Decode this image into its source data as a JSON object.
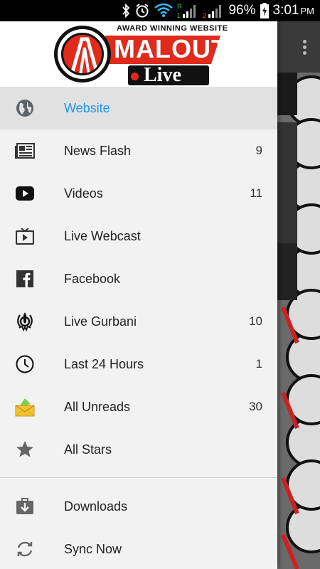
{
  "status_bar": {
    "battery": "96%",
    "time": "3:01",
    "ampm": "PM",
    "sim1_label": "R",
    "sim1_num": "1",
    "sim2_num": "2"
  },
  "header": {
    "logo_tagline": "AWARD WINNING WEBSITE",
    "logo_name": "MALOUT",
    "logo_live": "Live"
  },
  "nav": {
    "items": [
      {
        "label": "Website",
        "count": "",
        "icon": "globe-icon",
        "active": true
      },
      {
        "label": "News Flash",
        "count": "9",
        "icon": "newspaper-icon"
      },
      {
        "label": "Videos",
        "count": "11",
        "icon": "youtube-icon"
      },
      {
        "label": "Live Webcast",
        "count": "",
        "icon": "tv-icon"
      },
      {
        "label": "Facebook",
        "count": "",
        "icon": "facebook-icon"
      },
      {
        "label": "Live Gurbani",
        "count": "10",
        "icon": "khanda-icon"
      },
      {
        "label": "Last 24 Hours",
        "count": "1",
        "icon": "clock-icon"
      },
      {
        "label": "All Unreads",
        "count": "30",
        "icon": "envelope-icon"
      },
      {
        "label": "All Stars",
        "count": "",
        "icon": "star-icon"
      }
    ],
    "secondary": [
      {
        "label": "Downloads",
        "icon": "download-icon"
      },
      {
        "label": "Sync Now",
        "icon": "sync-icon"
      }
    ]
  },
  "colors": {
    "accent": "#2196f3",
    "brand_red": "#e02a1b",
    "drawer_bg": "#f2f2f2",
    "active_bg": "#e1e1e1"
  }
}
